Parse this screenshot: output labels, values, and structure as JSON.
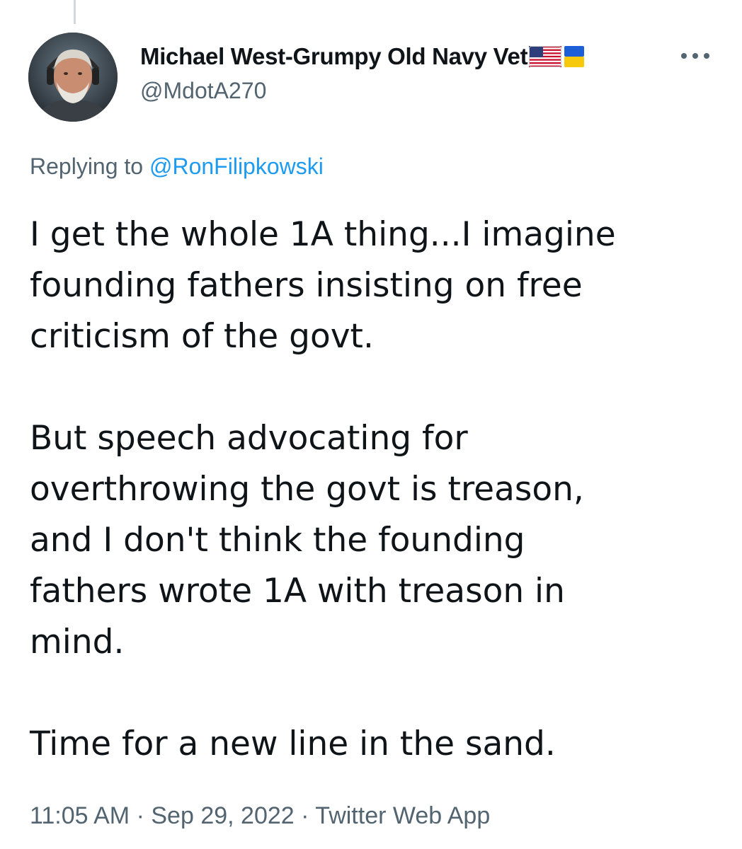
{
  "author": {
    "display_name": "Michael West-Grumpy Old Navy Vet",
    "handle": "@MdotA270",
    "flags": [
      "us-flag-icon",
      "ukraine-flag-icon"
    ]
  },
  "reply": {
    "prefix": "Replying to",
    "mention": "@RonFilipkowski"
  },
  "tweet": {
    "paragraphs": [
      [
        "I get the whole 1A thing...I imagine",
        "founding fathers insisting on free",
        "criticism of the govt."
      ],
      [
        "But speech advocating for",
        "overthrowing the govt is treason,",
        "and I don't think the founding",
        "fathers wrote 1A with treason in",
        "mind."
      ],
      [
        "Time for a new line in the sand."
      ]
    ]
  },
  "meta": {
    "time": "11:05 AM",
    "date": "Sep 29, 2022",
    "source": "Twitter Web App",
    "separator": "·"
  },
  "colors": {
    "text": "#0f1419",
    "secondary": "#536471",
    "link": "#1d9bf0"
  }
}
